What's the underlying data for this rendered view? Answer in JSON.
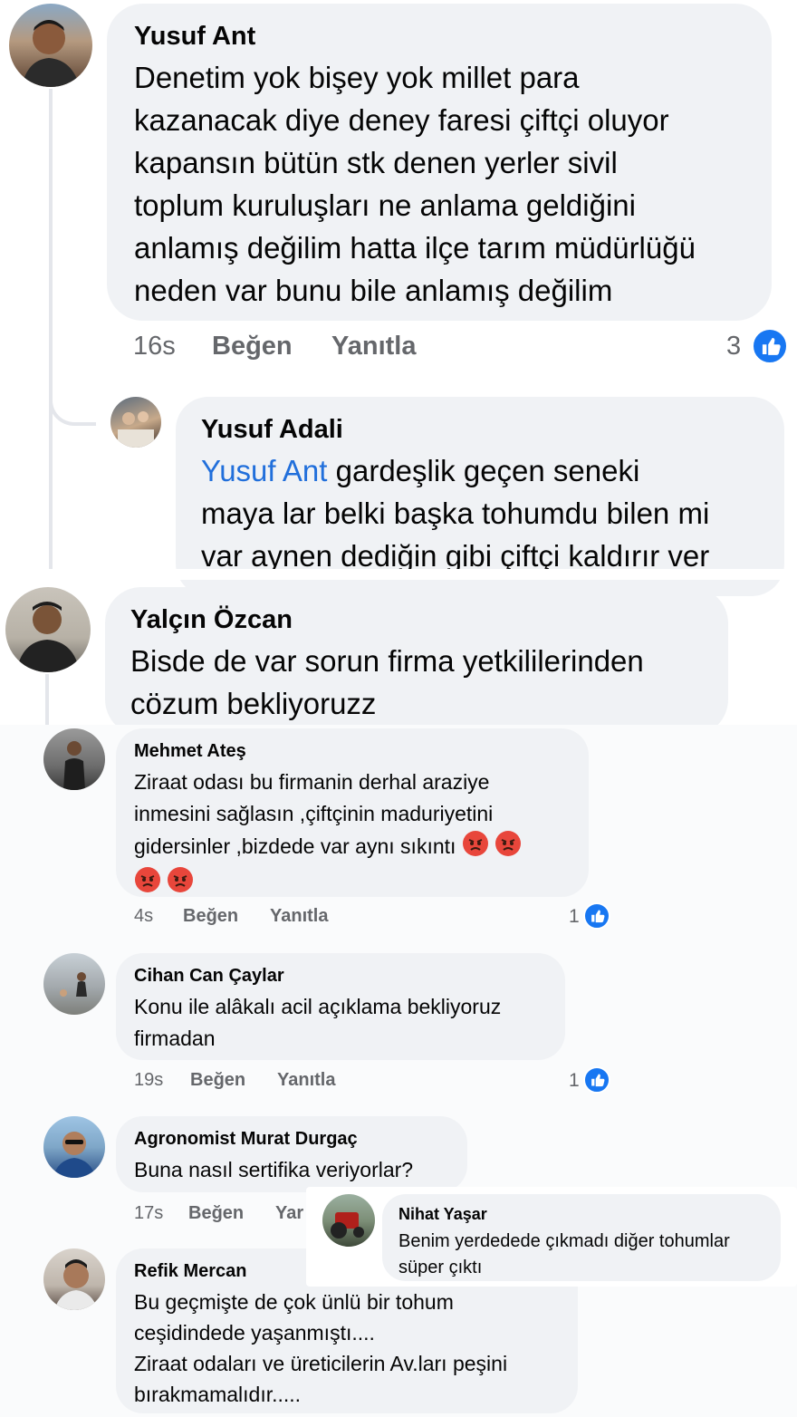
{
  "comments": [
    {
      "name": "Yusuf Ant",
      "text": "Denetim yok bişey yok millet para\nkazanacak diye deney faresi çiftçi oluyor\nkapansın bütün stk denen yerler sivil\ntoplum kuruluşları ne anlama geldiğini\nanlamış değilim hatta ilçe tarım müdürlüğü\nneden var bunu bile anlamış değilim",
      "time": "16s",
      "like_label": "Beğen",
      "reply_label": "Yanıtla",
      "reactions": "3"
    },
    {
      "name": "Yusuf Adali",
      "mention": "Yusuf Ant",
      "text_line1": " gardeşlik geçen seneki",
      "text_rest": "maya lar belki başka tohumdu bilen mi\nvar aynen dediğin gibi çiftçi kaldırır ver"
    },
    {
      "name": "Yalçın Özcan",
      "text": "Bisde de var sorun firma yetkililerinden\ncözum bekliyoruzz"
    },
    {
      "name": "Mehmet Ateş",
      "text": "Ziraat odası bu firmanin  derhal araziye\ninmesini sağlasın ,çiftçinin maduriyetini\ngidersinler ,bizdede var aynı sıkıntı",
      "emoji_name": "angry-face",
      "time": "4s",
      "like_label": "Beğen",
      "reply_label": "Yanıtla",
      "reactions": "1"
    },
    {
      "name": "Cihan Can Çaylar",
      "text": "Konu ile alâkalı acil açıklama bekliyoruz\nfirmadan",
      "time": "19s",
      "like_label": "Beğen",
      "reply_label": "Yanıtla",
      "reactions": "1"
    },
    {
      "name": "Agronomist Murat Durgaç",
      "text": "Buna nasıl sertifika veriyorlar?",
      "time": "17s",
      "like_label": "Beğen",
      "reply_label": "Yar"
    },
    {
      "name": "Nihat Yaşar",
      "text": "Benim yerdedede çıkmadı diğer tohumlar\nsüper çıktı"
    },
    {
      "name": "Refik Mercan",
      "text": "Bu geçmişte de  çok ünlü bir tohum\nceşidindede yaşanmıştı....\nZiraat odaları ve üreticilerin Av.ları peşini\nbırakmamalıdır....."
    }
  ],
  "colors": {
    "bubble": "#f0f2f5",
    "like_blue": "#1877f2",
    "mention": "#216fdb",
    "meta_gray": "#65676b",
    "angry_red": "#e8463b"
  },
  "icons": {
    "reaction": "like-thumbs-up-icon",
    "emoji": "angry-face-emoji"
  }
}
